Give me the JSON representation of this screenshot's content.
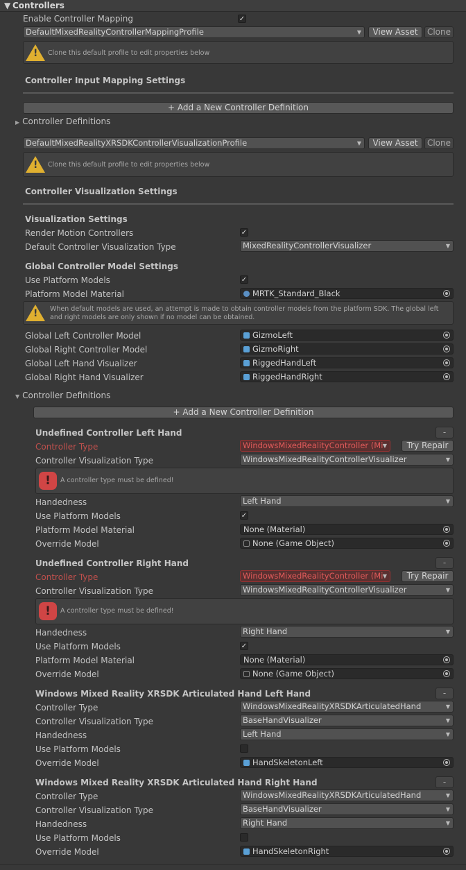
{
  "header": {
    "title": "Controllers"
  },
  "mapping": {
    "enable_label": "Enable Controller Mapping",
    "enabled": true,
    "profile": "DefaultMixedRealityControllerMappingProfile",
    "view_asset": "View Asset",
    "clone": "Clone",
    "help": "Clone this default profile to edit properties below",
    "settings_title": "Controller Input Mapping Settings",
    "add_button": "+ Add a New Controller Definition",
    "definitions_label": "Controller Definitions"
  },
  "visualization": {
    "profile": "DefaultMixedRealityXRSDKControllerVisualizationProfile",
    "view_asset": "View Asset",
    "clone": "Clone",
    "help": "Clone this default profile to edit properties below",
    "settings_title": "Controller Visualization Settings",
    "vis_settings_title": "Visualization Settings",
    "render_label": "Render Motion Controllers",
    "render_checked": true,
    "default_type_label": "Default Controller Visualization Type",
    "default_type_value": "MixedRealityControllerVisualizer",
    "global_title": "Global Controller Model Settings",
    "use_platform_label": "Use Platform Models",
    "use_platform_checked": true,
    "platform_material_label": "Platform Model Material",
    "platform_material_value": "MRTK_Standard_Black",
    "help_models": "When default models are used, an attempt is made to obtain controller models from the platform SDK. The global left and right models are only shown if no model can be obtained.",
    "global_left_label": "Global Left Controller Model",
    "global_left_value": "GizmoLeft",
    "global_right_label": "Global Right Controller Model",
    "global_right_value": "GizmoRight",
    "left_hand_label": "Global Left Hand Visualizer",
    "left_hand_value": "RiggedHandLeft",
    "right_hand_label": "Global Right Hand Visualizer",
    "right_hand_value": "RiggedHandRight",
    "definitions_label": "Controller Definitions",
    "add_button": "+ Add a New Controller Definition"
  },
  "labels": {
    "controller_type": "Controller Type",
    "vis_type": "Controller Visualization Type",
    "handedness": "Handedness",
    "use_platform": "Use Platform Models",
    "platform_material": "Platform Model Material",
    "override_model": "Override Model",
    "remove": "-",
    "try_repair": "Try Repair",
    "error": "A controller type must be defined!"
  },
  "definitions": [
    {
      "title": "Undefined Controller Left Hand",
      "controller_type": "WindowsMixedRealityController (Mi",
      "vis_type": "WindowsMixedRealityControllerVisualizer",
      "handedness": "Left Hand",
      "use_platform": true,
      "platform_material": "None (Material)",
      "override_model": "None (Game Object)"
    },
    {
      "title": "Undefined Controller Right Hand",
      "controller_type": "WindowsMixedRealityController (Mi",
      "vis_type": "WindowsMixedRealityControllerVisualizer",
      "handedness": "Right Hand",
      "use_platform": true,
      "platform_material": "None (Material)",
      "override_model": "None (Game Object)"
    },
    {
      "title": "Windows Mixed Reality XRSDK Articulated Hand Left Hand",
      "controller_type": "WindowsMixedRealityXRSDKArticulatedHand",
      "vis_type": "BaseHandVisualizer",
      "handedness": "Left Hand",
      "use_platform": false,
      "override_model": "HandSkeletonLeft"
    },
    {
      "title": "Windows Mixed Reality XRSDK Articulated Hand Right Hand",
      "controller_type": "WindowsMixedRealityXRSDKArticulatedHand",
      "vis_type": "BaseHandVisualizer",
      "handedness": "Right Hand",
      "use_platform": false,
      "override_model": "HandSkeletonRight"
    }
  ]
}
